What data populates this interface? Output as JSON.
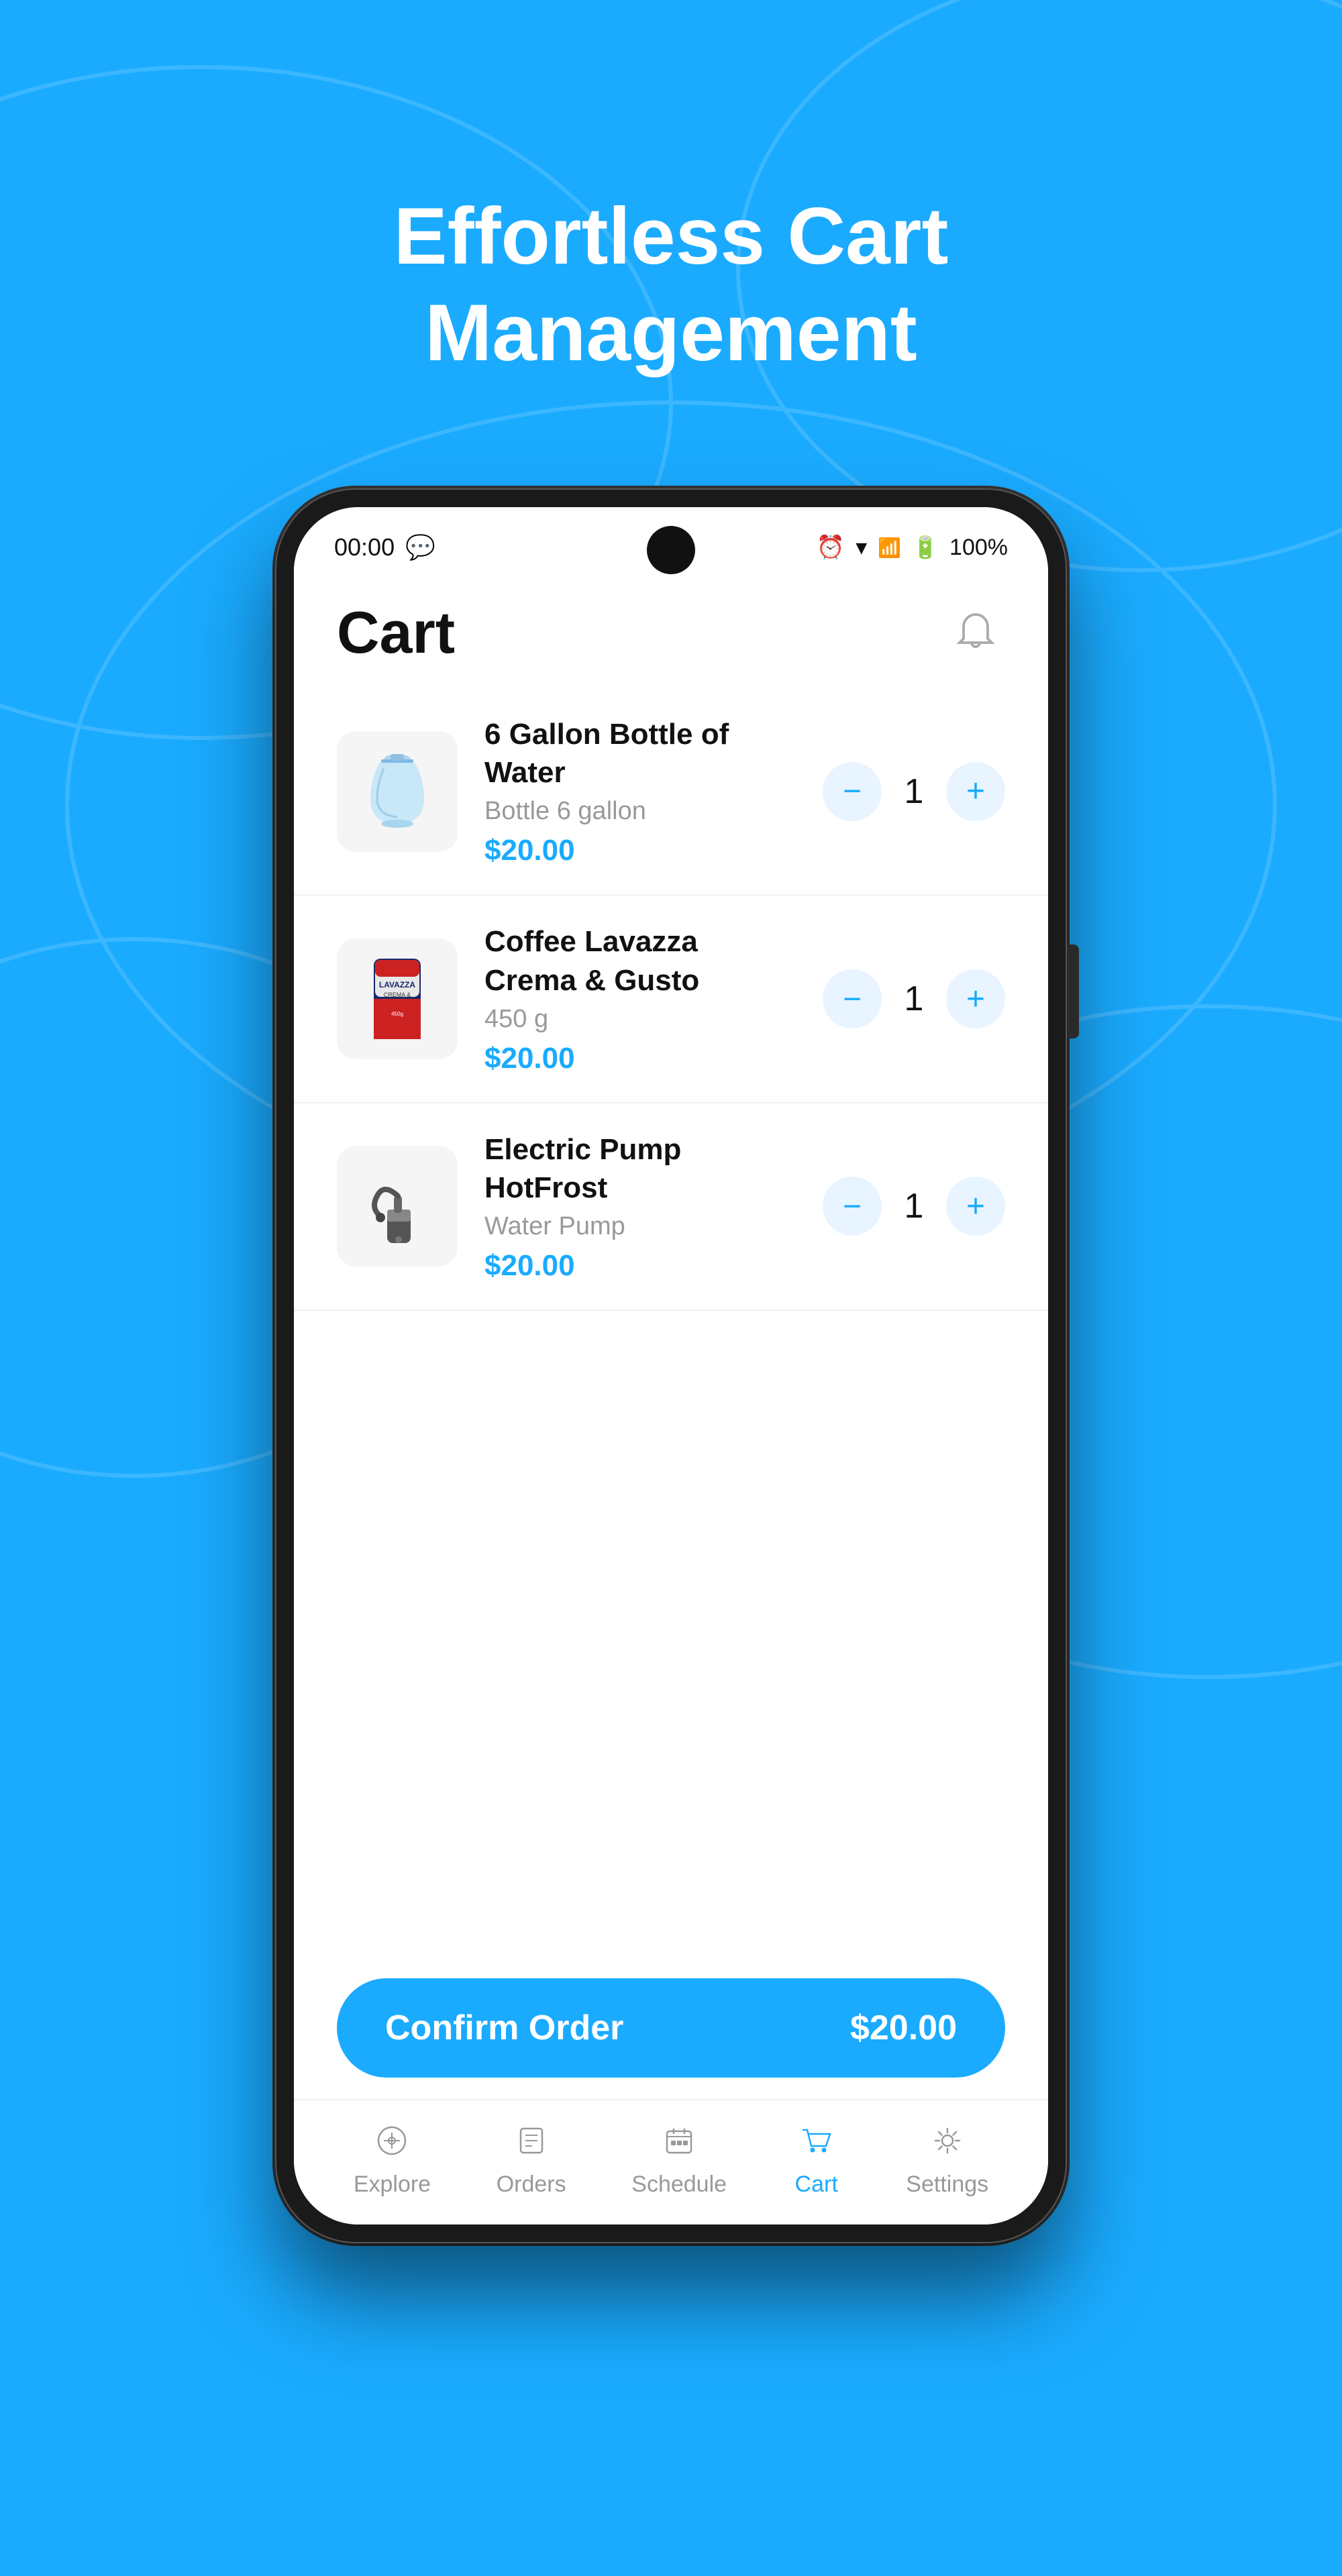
{
  "page": {
    "title_line1": "Effortless Cart",
    "title_line2": "Management",
    "background_color": "#1AABFF"
  },
  "status_bar": {
    "time": "00:00",
    "battery": "100%"
  },
  "app": {
    "header_title": "Cart",
    "notification_icon": "bell"
  },
  "cart_items": [
    {
      "id": 1,
      "name": "6 Gallon Bottle of Water",
      "subtitle": "Bottle 6 gallon",
      "price": "$20.00",
      "quantity": 1,
      "icon": "🪣"
    },
    {
      "id": 2,
      "name": "Coffee Lavazza Crema & Gusto",
      "subtitle": "450 g",
      "price": "$20.00",
      "quantity": 1,
      "icon": "☕"
    },
    {
      "id": 3,
      "name": "Electric Pump HotFrost",
      "subtitle": "Water Pump",
      "price": "$20.00",
      "quantity": 1,
      "icon": "🔧"
    }
  ],
  "confirm_button": {
    "label": "Confirm Order",
    "total": "$20.00"
  },
  "bottom_nav": [
    {
      "id": "explore",
      "label": "Explore",
      "active": false
    },
    {
      "id": "orders",
      "label": "Orders",
      "active": false
    },
    {
      "id": "schedule",
      "label": "Schedule",
      "active": false
    },
    {
      "id": "cart",
      "label": "Cart",
      "active": true
    },
    {
      "id": "settings",
      "label": "Settings",
      "active": false
    }
  ]
}
